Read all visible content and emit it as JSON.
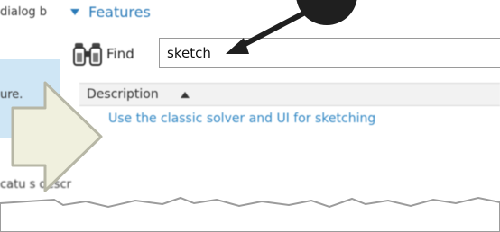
{
  "left_panel": {
    "top_text": "dialog b",
    "selected_text": "ure.",
    "bottom_text": "catu   s descr"
  },
  "features": {
    "title": "Features"
  },
  "find": {
    "label": "Find",
    "value": "sketch"
  },
  "table": {
    "column_header": "Description",
    "rows": [
      {
        "description": "Use the classic solver and UI for sketching"
      }
    ]
  },
  "colors": {
    "accent": "#2a7ab8",
    "result_text": "#3489c5",
    "selection": "#cfe6f5",
    "callout_arrow": "#f0f0de",
    "pointer_arrow": "#1f1f1f"
  },
  "icons": {
    "find": "binoculars-icon",
    "expand": "triangle-down-icon",
    "sort": "sort-ascending-icon"
  }
}
